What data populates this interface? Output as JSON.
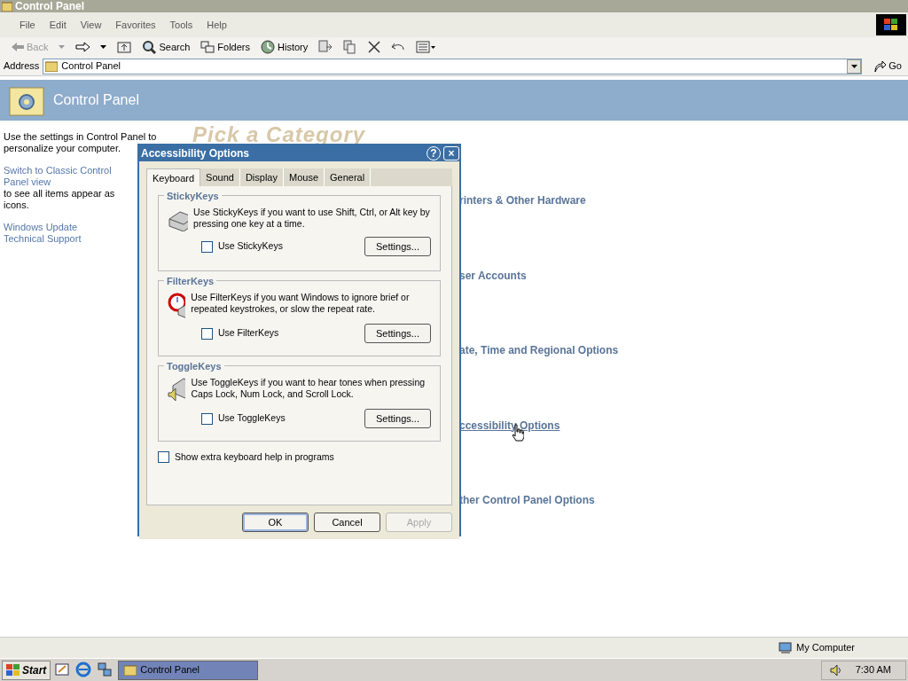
{
  "window": {
    "title": "Control Panel"
  },
  "menu": [
    "File",
    "Edit",
    "View",
    "Favorites",
    "Tools",
    "Help"
  ],
  "toolbar": [
    {
      "label": "Back",
      "disabled": true
    },
    {
      "label": "Search",
      "disabled": false
    },
    {
      "label": "Folders",
      "disabled": false
    },
    {
      "label": "History",
      "disabled": false
    }
  ],
  "address": {
    "label": "Address",
    "value": "Control Panel",
    "go": "Go"
  },
  "header": {
    "title": "Control Panel"
  },
  "sidebar": {
    "intro_lines": [
      "Use the settings in Control Panel to",
      "personalize your computer."
    ],
    "switch_link": "Switch to Classic Control Panel view",
    "switch_rest": " to see all items appear as icons.",
    "links": [
      "Windows Update",
      "Technical Support"
    ]
  },
  "main": {
    "heading": "Pick a Category",
    "categories": [
      {
        "label": "rinters & Other Hardware",
        "hovered": false
      },
      {
        "label": "ser Accounts",
        "hovered": false
      },
      {
        "label": "ate, Time and Regional Options",
        "hovered": false
      },
      {
        "label": "ccessibility Options",
        "hovered": true
      },
      {
        "label": "ther Control Panel Options",
        "hovered": false
      }
    ]
  },
  "dialog": {
    "title": "Accessibility Options",
    "help": "?",
    "close": "×",
    "tabs": [
      {
        "label": "Keyboard",
        "selected": true
      },
      {
        "label": "Sound",
        "selected": false
      },
      {
        "label": "Display",
        "selected": false
      },
      {
        "label": "Mouse",
        "selected": false
      },
      {
        "label": "General",
        "selected": false
      }
    ],
    "groups": [
      {
        "kind": "sticky",
        "title": "StickyKeys",
        "description": "Use StickyKeys if you want to use Shift, Ctrl, or Alt key by pressing one key at a time.",
        "checkbox": {
          "label": "Use StickyKeys",
          "checked": false
        },
        "button": "Settings..."
      },
      {
        "kind": "filter",
        "title": "FilterKeys",
        "description": "Use FilterKeys if you want Windows to ignore brief or repeated keystrokes, or slow the repeat rate.",
        "checkbox": {
          "label": "Use FilterKeys",
          "checked": false
        },
        "button": "Settings..."
      },
      {
        "kind": "toggle",
        "title": "ToggleKeys",
        "description": "Use ToggleKeys if you want to hear tones when pressing Caps Lock, Num Lock, and Scroll Lock.",
        "checkbox": {
          "label": "Use ToggleKeys",
          "checked": false
        },
        "button": "Settings..."
      }
    ],
    "extra": {
      "label": "Show extra keyboard help in programs",
      "checked": false
    },
    "buttons": [
      {
        "label": "OK",
        "default": true,
        "disabled": false
      },
      {
        "label": "Cancel",
        "default": false,
        "disabled": false
      },
      {
        "label": "Apply",
        "default": false,
        "disabled": true
      }
    ]
  },
  "status_bar": {
    "zone": "My Computer"
  },
  "taskbar": {
    "start": "Start",
    "tasks": [
      {
        "label": "Control Panel",
        "selected": true
      }
    ],
    "clock": "7:30 AM"
  }
}
